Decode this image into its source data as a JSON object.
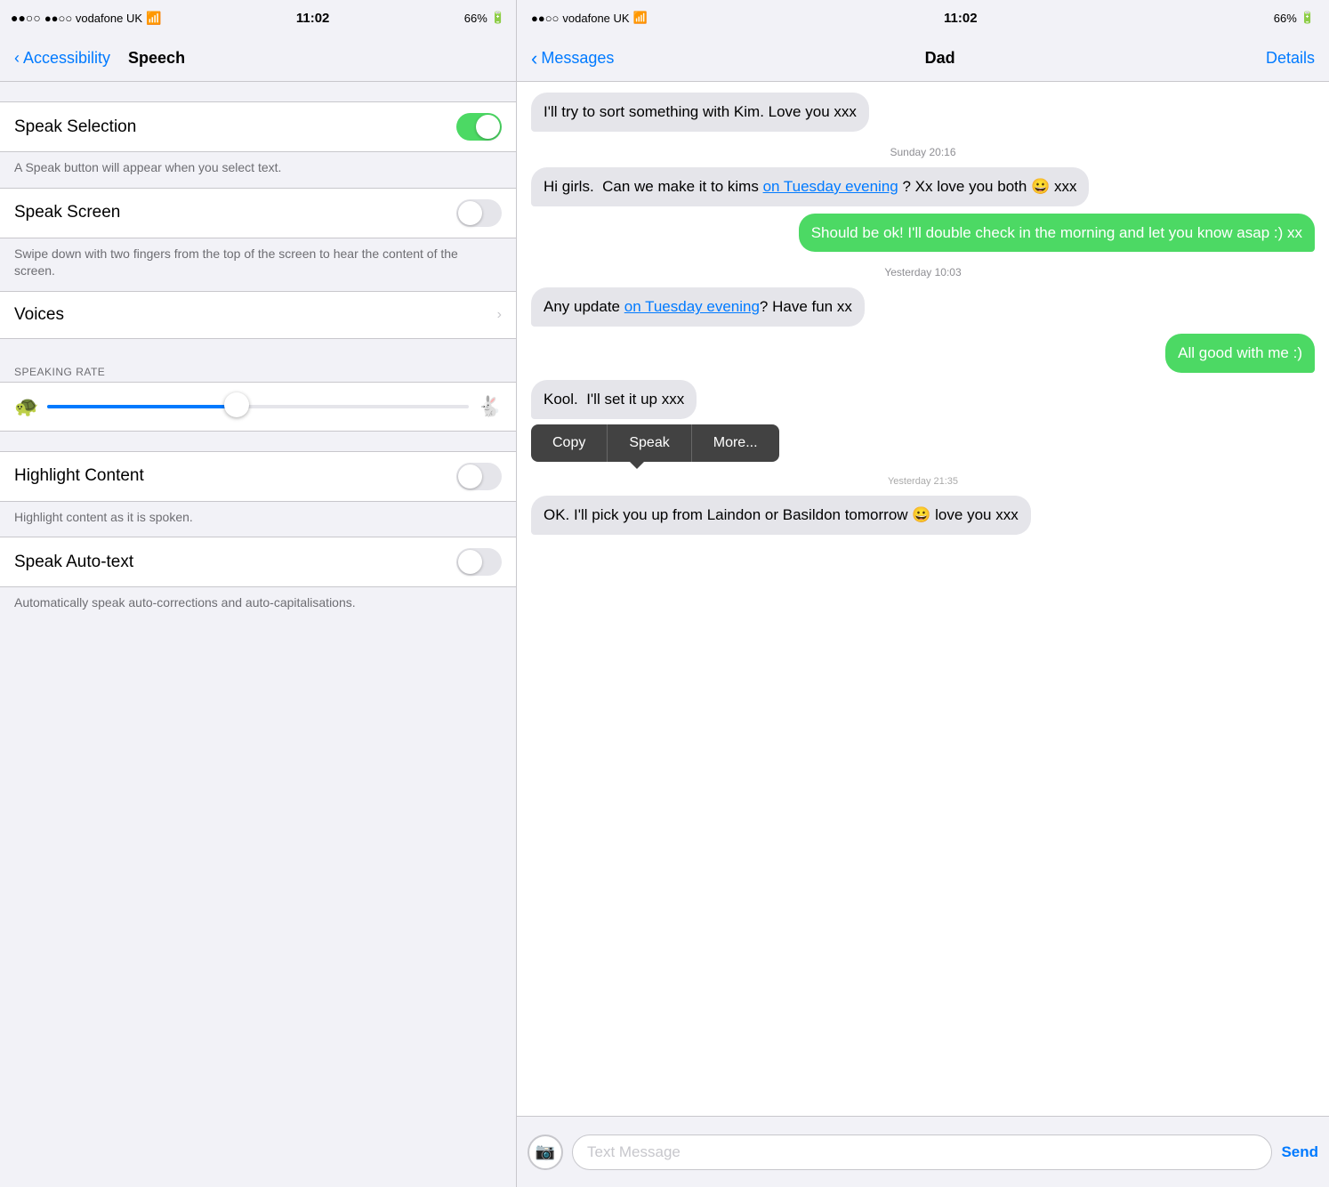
{
  "left": {
    "statusBar": {
      "carrier": "●●○○ vodafone UK",
      "wifi": "WiFi",
      "time": "11:02",
      "battery": "66%"
    },
    "navBack": "Accessibility",
    "navTitle": "Speech",
    "settings": {
      "speakSelectionLabel": "Speak Selection",
      "speakSelectionDescription": "A Speak button will appear when you select text.",
      "speakScreenLabel": "Speak Screen",
      "speakScreenDescription": "Swipe down with two fingers from the top of the screen to hear the content of the screen.",
      "voicesLabel": "Voices",
      "speakingRateLabel": "SPEAKING RATE",
      "highlightContentLabel": "Highlight Content",
      "highlightContentDescription": "Highlight content as it is spoken.",
      "speakAutoTextLabel": "Speak Auto-text",
      "speakAutoTextDescription": "Automatically speak auto-corrections and auto-capitalisations."
    }
  },
  "right": {
    "statusBar": {
      "carrier": "●●○○ vodafone UK",
      "wifi": "WiFi",
      "time": "11:02",
      "battery": "66%"
    },
    "navBack": "Messages",
    "navTitle": "Dad",
    "navDetails": "Details",
    "messages": [
      {
        "id": 1,
        "type": "incoming",
        "text": "I'll try to sort something with Kim. Love you xxx",
        "timestamp": null
      },
      {
        "id": 2,
        "type": "timestamp",
        "text": "Sunday 20:16"
      },
      {
        "id": 3,
        "type": "incoming",
        "text": "Hi girls.  Can we make it to kims",
        "link": "on Tuesday evening",
        "textAfter": " ? Xx love you both 😀 xxx"
      },
      {
        "id": 4,
        "type": "outgoing",
        "text": "Should be ok! I'll double check in the morning and let you know asap :) xx"
      },
      {
        "id": 5,
        "type": "timestamp",
        "text": "Yesterday 10:03"
      },
      {
        "id": 6,
        "type": "incoming",
        "text": "Any update",
        "link": "on Tuesday evening",
        "textAfter": "? Have fun xx"
      },
      {
        "id": 7,
        "type": "outgoing",
        "text": "All good with me :)"
      },
      {
        "id": 8,
        "type": "incoming-with-menu",
        "text": "Kool.  I'll set it up xxx",
        "menu": [
          "Copy",
          "Speak",
          "More..."
        ]
      },
      {
        "id": 9,
        "type": "timestamp-small",
        "text": "Yesterday 21:35"
      },
      {
        "id": 10,
        "type": "incoming",
        "text": "OK. I'll pick you up from Laindon or Basildon tomorrow 😀 love you xxx"
      }
    ],
    "inputPlaceholder": "Text Message",
    "sendLabel": "Send"
  }
}
